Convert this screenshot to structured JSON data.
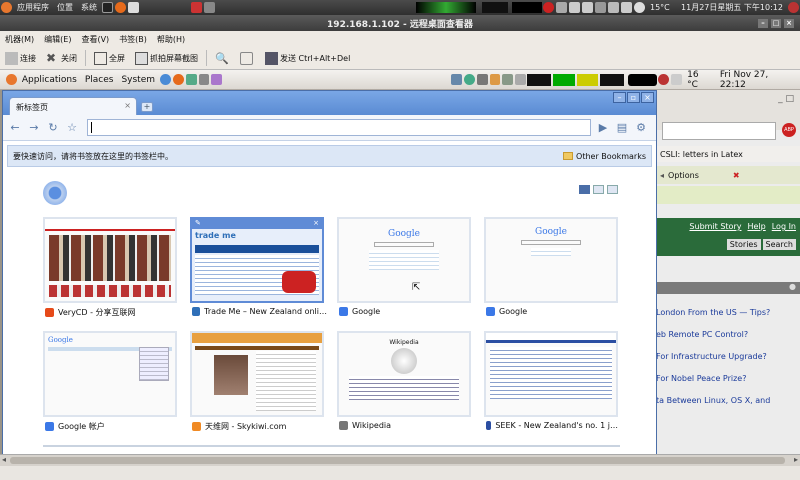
{
  "outer_panel": {
    "menus": [
      "应用程序",
      "位置",
      "系统"
    ],
    "temp": "15°C",
    "datetime": "11月27日星期五 下午10:12"
  },
  "rdc": {
    "title": "192.168.1.102 - 远程桌面查看器",
    "menus": [
      "机器(M)",
      "编辑(E)",
      "查看(V)",
      "书签(B)",
      "帮助(H)"
    ],
    "toolbar": {
      "connect": "连接",
      "close": "关闭",
      "fullscreen": "全屏",
      "screenshot": "抓拍屏幕截图",
      "send": "发送 Ctrl+Alt+Del"
    }
  },
  "remote_panel": {
    "menus": [
      "Applications",
      "Places",
      "System"
    ],
    "temp": "16 °C",
    "datetime": "Fri Nov 27, 22:12"
  },
  "chrome": {
    "tab_title": "新标签页",
    "bookmark_hint": "要快速访问，请将书签放在这里的书签栏中。",
    "other_bookmarks": "Other Bookmarks",
    "thumbs": [
      {
        "label": "VeryCD - 分享互联网",
        "favicon": "#e64a19"
      },
      {
        "label": "Trade Me – New Zealand onli…",
        "favicon": "#2f6fb8",
        "hint": "trade me"
      },
      {
        "label": "Google",
        "favicon": "#3b78e7",
        "hint": "Google"
      },
      {
        "label": "Google",
        "favicon": "#3b78e7",
        "hint": "Google"
      },
      {
        "label": "Google 帐户",
        "favicon": "#3b78e7",
        "hint": "Google"
      },
      {
        "label": "天维网 - Skykiwi.com",
        "favicon": "#f08a24"
      },
      {
        "label": "Wikipedia",
        "favicon": "#777777",
        "hint": "Wikipedia"
      },
      {
        "label": "SEEK - New Zealand's no. 1 j…",
        "favicon": "#2b4ea2"
      }
    ]
  },
  "firefox_bg": {
    "tab": "CSLI: letters in Latex",
    "options": "Options",
    "submit": "Submit Story",
    "help": "Help",
    "login": "Log In",
    "stories": "Stories",
    "search": "Search",
    "links": [
      "London From the US — Tips?",
      "eb Remote PC Control?",
      "For Infrastructure Upgrade?",
      "For Nobel Peace Prize?",
      "ta Between Linux, OS X, and"
    ]
  }
}
